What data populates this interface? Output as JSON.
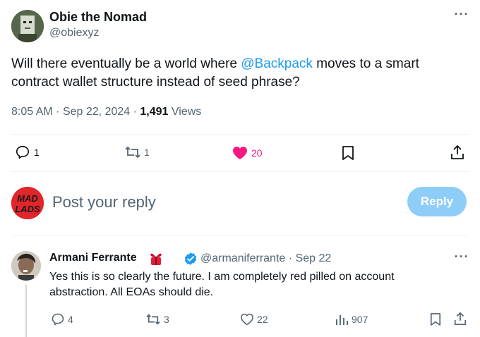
{
  "post": {
    "author_name": "Obie the Nomad",
    "author_handle": "@obiexyz",
    "text_before": "Will there eventually be a world where ",
    "mention": "@Backpack",
    "text_after": " moves to a smart contract wallet structure instead of seed phrase?",
    "time": "8:05 AM",
    "date": "Sep 22, 2024",
    "views_count": "1,491",
    "views_label": "Views",
    "replies": "1",
    "reposts": "1",
    "likes": "20"
  },
  "composer": {
    "placeholder": "Post your reply",
    "reply_label": "Reply",
    "avatar_text": "MAD LADS"
  },
  "reply": {
    "author_name": "Armani Ferrante",
    "author_handle": "@armaniferrante",
    "date": "Sep 22",
    "text": "Yes this is so clearly the future. I am completely red pilled on account abstraction. All EOAs should die.",
    "replies": "4",
    "reposts": "3",
    "likes": "22",
    "views": "907"
  },
  "icons": {
    "more": "more-horizontal-icon",
    "reply": "reply-icon",
    "repost": "repost-icon",
    "like": "heart-icon",
    "bookmark": "bookmark-icon",
    "share": "share-icon",
    "views": "analytics-icon",
    "verified": "verified-badge-icon",
    "emoji": "red-gift-emoji-icon"
  },
  "colors": {
    "link": "#1d9bf0",
    "like_active": "#f91880",
    "reply_button": "#8ecdf7",
    "secondary_text": "#536471"
  }
}
